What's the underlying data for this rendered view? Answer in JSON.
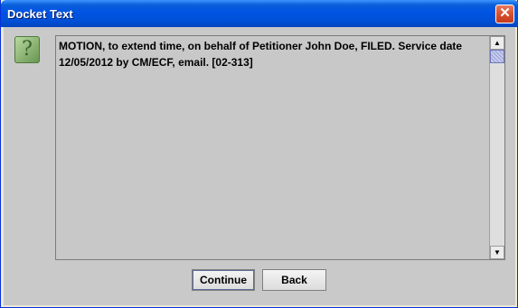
{
  "window": {
    "title": "Docket Text",
    "close_glyph": "✕"
  },
  "dialog": {
    "icon": "help-question-icon",
    "icon_glyph": "?",
    "message": "MOTION, to extend time, on behalf of Petitioner John Doe, FILED. Service date 12/05/2012 by CM/ECF, email. [02-313]"
  },
  "scrollbar": {
    "up_glyph": "▲",
    "down_glyph": "▼"
  },
  "buttons": {
    "continue_label": "Continue",
    "back_label": "Back"
  },
  "colors": {
    "titlebar": "#0054e3",
    "client_bg": "#c9c9c9",
    "scroll_thumb": "#9aa3d9"
  }
}
